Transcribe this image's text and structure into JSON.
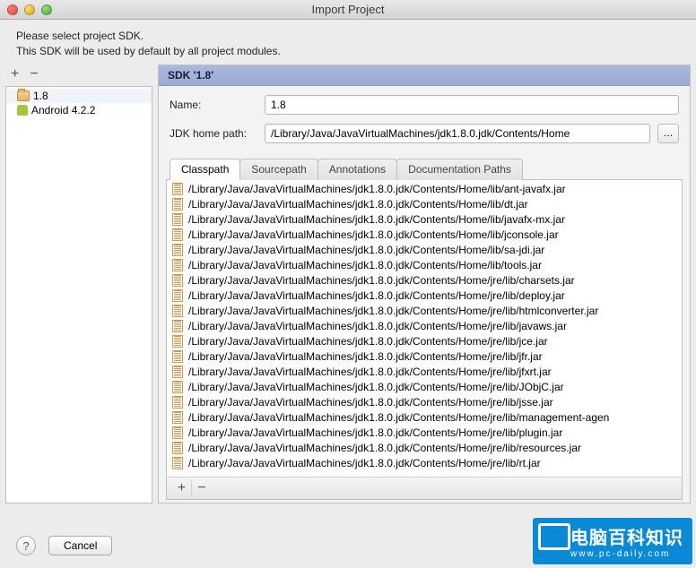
{
  "window": {
    "title": "Import Project"
  },
  "instructions": {
    "line1": "Please select project SDK.",
    "line2": "This SDK will be used by default by all project modules."
  },
  "left_toolbar": {
    "add": "+",
    "remove": "−"
  },
  "sdk_tree": [
    {
      "icon": "folder",
      "label": "1.8",
      "selected": true
    },
    {
      "icon": "android",
      "label": "Android 4.2.2",
      "selected": false
    }
  ],
  "sdk_panel": {
    "header": "SDK '1.8'",
    "name_label": "Name:",
    "name_value": "1.8",
    "home_label": "JDK home path:",
    "home_value": "/Library/Java/JavaVirtualMachines/jdk1.8.0.jdk/Contents/Home",
    "browse": "…"
  },
  "tabs": [
    {
      "label": "Classpath",
      "active": true
    },
    {
      "label": "Sourcepath",
      "active": false
    },
    {
      "label": "Annotations",
      "active": false
    },
    {
      "label": "Documentation Paths",
      "active": false
    }
  ],
  "classpath": [
    "/Library/Java/JavaVirtualMachines/jdk1.8.0.jdk/Contents/Home/lib/ant-javafx.jar",
    "/Library/Java/JavaVirtualMachines/jdk1.8.0.jdk/Contents/Home/lib/dt.jar",
    "/Library/Java/JavaVirtualMachines/jdk1.8.0.jdk/Contents/Home/lib/javafx-mx.jar",
    "/Library/Java/JavaVirtualMachines/jdk1.8.0.jdk/Contents/Home/lib/jconsole.jar",
    "/Library/Java/JavaVirtualMachines/jdk1.8.0.jdk/Contents/Home/lib/sa-jdi.jar",
    "/Library/Java/JavaVirtualMachines/jdk1.8.0.jdk/Contents/Home/lib/tools.jar",
    "/Library/Java/JavaVirtualMachines/jdk1.8.0.jdk/Contents/Home/jre/lib/charsets.jar",
    "/Library/Java/JavaVirtualMachines/jdk1.8.0.jdk/Contents/Home/jre/lib/deploy.jar",
    "/Library/Java/JavaVirtualMachines/jdk1.8.0.jdk/Contents/Home/jre/lib/htmlconverter.jar",
    "/Library/Java/JavaVirtualMachines/jdk1.8.0.jdk/Contents/Home/jre/lib/javaws.jar",
    "/Library/Java/JavaVirtualMachines/jdk1.8.0.jdk/Contents/Home/jre/lib/jce.jar",
    "/Library/Java/JavaVirtualMachines/jdk1.8.0.jdk/Contents/Home/jre/lib/jfr.jar",
    "/Library/Java/JavaVirtualMachines/jdk1.8.0.jdk/Contents/Home/jre/lib/jfxrt.jar",
    "/Library/Java/JavaVirtualMachines/jdk1.8.0.jdk/Contents/Home/jre/lib/JObjC.jar",
    "/Library/Java/JavaVirtualMachines/jdk1.8.0.jdk/Contents/Home/jre/lib/jsse.jar",
    "/Library/Java/JavaVirtualMachines/jdk1.8.0.jdk/Contents/Home/jre/lib/management-agen",
    "/Library/Java/JavaVirtualMachines/jdk1.8.0.jdk/Contents/Home/jre/lib/plugin.jar",
    "/Library/Java/JavaVirtualMachines/jdk1.8.0.jdk/Contents/Home/jre/lib/resources.jar",
    "/Library/Java/JavaVirtualMachines/jdk1.8.0.jdk/Contents/Home/jre/lib/rt.jar"
  ],
  "list_toolbar": {
    "add": "+",
    "remove": "−"
  },
  "footer": {
    "help": "?",
    "cancel": "Cancel"
  },
  "watermark": {
    "main": "电脑百科知识",
    "sub": "www.pc-daily.com"
  }
}
